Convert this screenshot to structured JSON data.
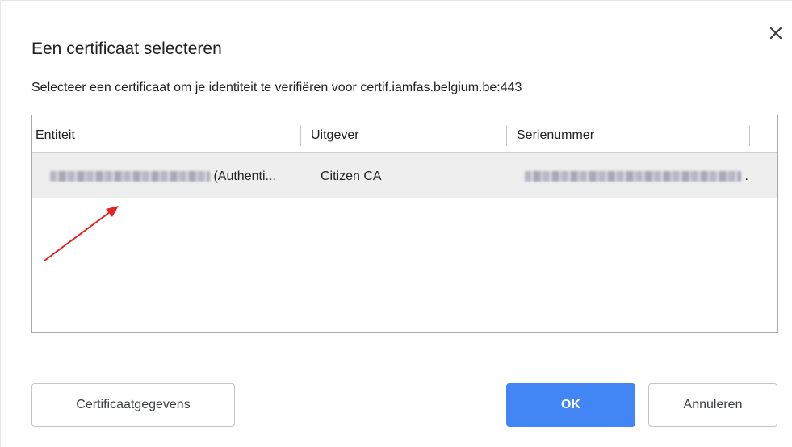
{
  "dialog": {
    "title": "Een certificaat selecteren",
    "subtitle": "Selecteer een certificaat om je identiteit te verifiëren voor certif.iamfas.belgium.be:443",
    "close_icon": "close-icon"
  },
  "table": {
    "columns": [
      "Entiteit",
      "Uitgever",
      "Serienummer"
    ],
    "rows": [
      {
        "entity_suffix": "(Authenti...",
        "issuer": "Citizen CA",
        "serial_suffix": ".",
        "selected": true
      }
    ]
  },
  "annotation": {
    "arrow_color": "#e8201f"
  },
  "buttons": {
    "details": "Certificaatgegevens",
    "ok": "OK",
    "cancel": "Annuleren"
  },
  "colors": {
    "accent": "#4285f4",
    "selected_row": "#eeeeee"
  }
}
